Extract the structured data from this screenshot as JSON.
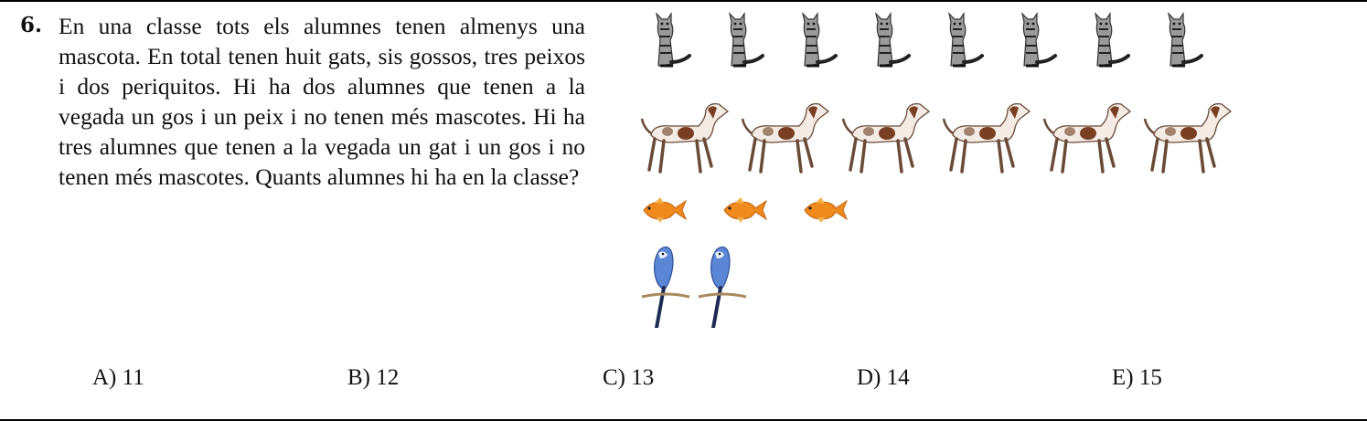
{
  "question": {
    "number": "6.",
    "text": "En una classe tots els alumnes tenen almenys una mascota. En total tenen huit gats, sis gossos, tres peixos i dos periquitos. Hi ha dos alumnes que tenen a la vegada un gos i un peix i no tenen més mascotes. Hi ha tres alumnes que tenen a la vegada un gat i un gos i no tenen més mascotes. Quants alumnes hi ha en la classe?"
  },
  "illustration": {
    "cats": 8,
    "dogs": 6,
    "fish": 3,
    "parakeets": 2,
    "icons": [
      "cat-icon",
      "dog-icon",
      "goldfish-icon",
      "parakeet-icon"
    ],
    "colors": {
      "cat_fur": "#9a9a9a",
      "dog_patch": "#7a3f22",
      "fish": "#f08a1c",
      "parakeet": "#5b86d6"
    }
  },
  "choices": [
    {
      "label": "A)",
      "value": "11"
    },
    {
      "label": "B)",
      "value": "12"
    },
    {
      "label": "C)",
      "value": "13"
    },
    {
      "label": "D)",
      "value": "14"
    },
    {
      "label": "E)",
      "value": "15"
    }
  ]
}
